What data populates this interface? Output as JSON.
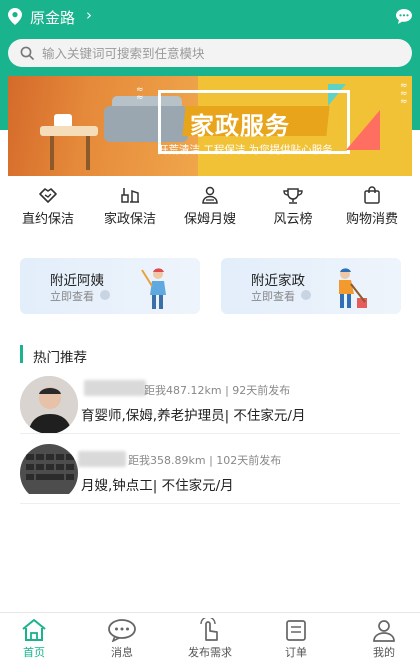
{
  "header": {
    "location": "原金路",
    "location_chevron": "›"
  },
  "search": {
    "placeholder": "输入关键词可搜索到任意模块"
  },
  "banner": {
    "title": "家政服务",
    "subtitle": "开荒清洁 工程保洁 为您提供贴心服务"
  },
  "categories": [
    {
      "label": "直约保洁",
      "icon": "handshake-icon"
    },
    {
      "label": "家政保洁",
      "icon": "cleaning-icon"
    },
    {
      "label": "保姆月嫂",
      "icon": "nanny-icon"
    },
    {
      "label": "风云榜",
      "icon": "ranking-icon"
    },
    {
      "label": "购物消费",
      "icon": "shopping-bag-icon"
    }
  ],
  "cards": [
    {
      "title": "附近阿姨",
      "sub": "立即查看"
    },
    {
      "title": "附近家政",
      "sub": "立即查看"
    }
  ],
  "section": {
    "title": "热门推荐"
  },
  "list": [
    {
      "meta": "距我487.12km | 92天前发布",
      "desc": "育婴师,保姆,养老护理员| 不住家元/月"
    },
    {
      "meta": "距我358.89km | 102天前发布",
      "desc": "月嫂,钟点工| 不住家元/月"
    }
  ],
  "tabbar": [
    {
      "label": "首页",
      "icon": "home-icon"
    },
    {
      "label": "消息",
      "icon": "chat-icon"
    },
    {
      "label": "发布需求",
      "icon": "publish-icon"
    },
    {
      "label": "订单",
      "icon": "order-icon"
    },
    {
      "label": "我的",
      "icon": "profile-icon"
    }
  ],
  "colors": {
    "primary": "#19b38e",
    "banner_yellow": "#f2c236",
    "banner_orange": "#e5893a"
  }
}
